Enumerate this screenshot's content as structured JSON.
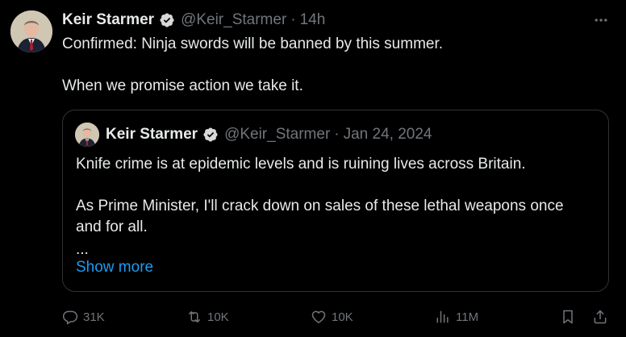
{
  "tweet": {
    "author_name": "Keir Starmer",
    "handle": "@Keir_Starmer",
    "separator": "·",
    "time": "14h",
    "text_line1": "Confirmed: Ninja swords will be banned by this summer.",
    "text_line2": "When we promise action we take it."
  },
  "quoted": {
    "author_name": "Keir Starmer",
    "handle": "@Keir_Starmer",
    "separator": "·",
    "date": "Jan 24, 2024",
    "text_line1": "Knife crime is at epidemic levels and is ruining lives across Britain.",
    "text_line2": "As Prime Minister, I'll crack down on sales of these lethal weapons once",
    "text_line3": "and for all.",
    "ellipsis": "...",
    "show_more_label": "Show more"
  },
  "actions": {
    "replies": "31K",
    "reposts": "10K",
    "likes": "10K",
    "views": "11M"
  },
  "icons": {
    "verified": "verified-badge-icon",
    "more": "more-dots-icon",
    "reply": "reply-icon",
    "repost": "repost-icon",
    "like": "heart-icon",
    "views": "views-chart-icon",
    "bookmark": "bookmark-icon",
    "share": "share-icon"
  },
  "colors": {
    "background": "#000000",
    "text": "#e7e9ea",
    "secondary": "#71767b",
    "accent": "#1d9bf0",
    "border": "#2f3336"
  }
}
